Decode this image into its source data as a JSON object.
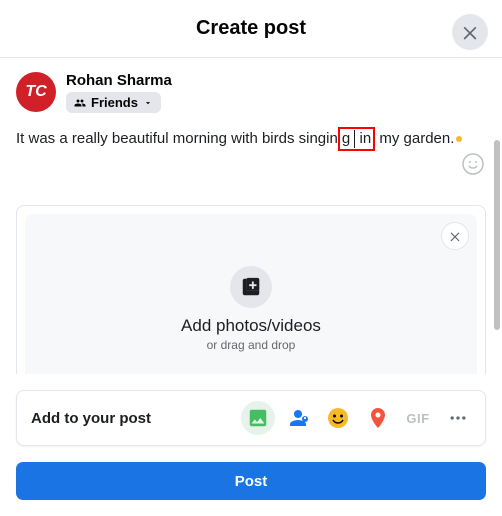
{
  "header": {
    "title": "Create post"
  },
  "user": {
    "avatar_text": "TC",
    "name": "Rohan Sharma",
    "audience_label": "Friends"
  },
  "composer": {
    "text_before": "It was a really beautiful morning with birds singin",
    "text_highlight_left": "g ",
    "text_highlight_right": " in",
    "text_after": " my garden."
  },
  "media": {
    "title": "Add photos/videos",
    "subtitle": "or drag and drop"
  },
  "addto": {
    "label": "Add to your post",
    "gif_label": "GIF"
  },
  "post_button": {
    "label": "Post"
  }
}
